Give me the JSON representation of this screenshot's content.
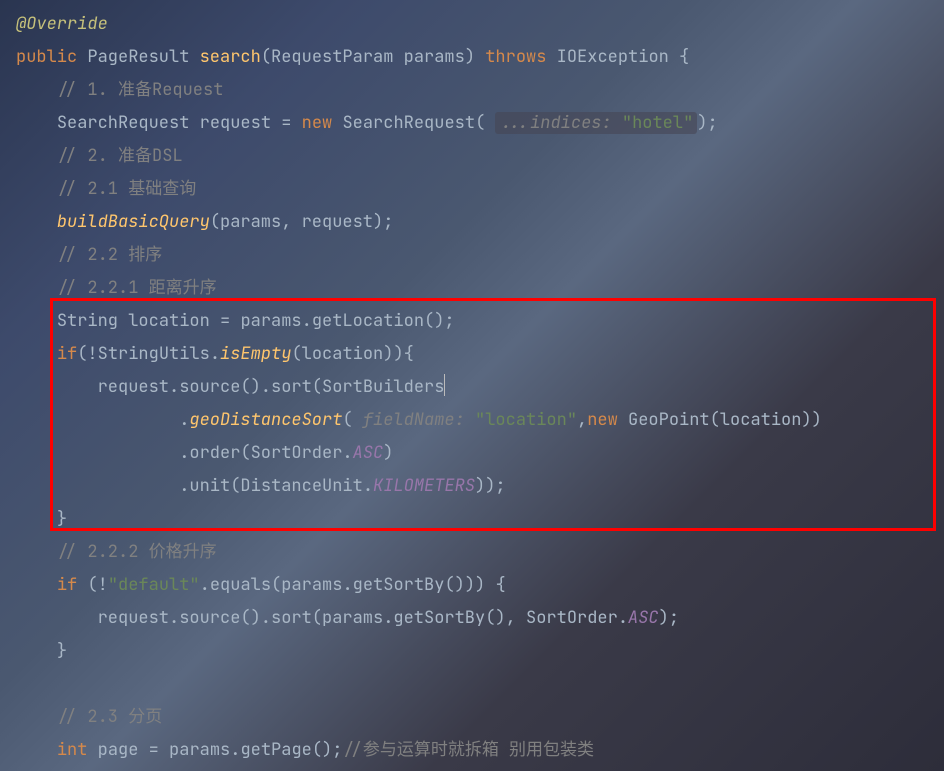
{
  "lines": {
    "l1_anno": "@Override",
    "l2_kw1": "public",
    "l2_type1": "PageResult",
    "l2_method": "search",
    "l2_type2": "RequestParam",
    "l2_param": "params",
    "l2_kw2": "throws",
    "l2_type3": "IOException",
    "l3_comment": "// 1. 准备Request",
    "l4_type": "SearchRequest",
    "l4_var": "request",
    "l4_kw": "new",
    "l4_ctor": "SearchRequest",
    "l4_hint": "...indices:",
    "l4_str": "\"hotel\"",
    "l5_comment": "// 2. 准备DSL",
    "l6_comment": "// 2.1 基础查询",
    "l7_call": "buildBasicQuery",
    "l7_args": "(params, request);",
    "l8_comment": "// 2.2 排序",
    "l9_comment": "// 2.2.1 距离升序",
    "l10_type": "String",
    "l10_var": "location",
    "l10_rhs": "params.getLocation();",
    "l11_kw": "if",
    "l11_cls": "StringUtils",
    "l11_m": "isEmpty",
    "l11_arg": "location",
    "l12_pre": "request.source().sort(",
    "l12_cls": "SortBuilders",
    "l13_m": "geoDistanceSort",
    "l13_hint": "fieldName:",
    "l13_str": "\"location\"",
    "l13_kw": "new",
    "l13_ctor": "GeoPoint",
    "l13_arg": "location",
    "l14_m": "order",
    "l14_cls": "SortOrder",
    "l14_f": "ASC",
    "l15_m": "unit",
    "l15_cls": "DistanceUnit",
    "l15_f": "KILOMETERS",
    "l17_comment": "// 2.2.2 价格升序",
    "l18_kw": "if",
    "l18_str": "\"default\"",
    "l18_m": "equals",
    "l18_args": "params.getSortBy()",
    "l19_pre": "request.source().sort(params.getSortBy(), ",
    "l19_cls": "SortOrder",
    "l19_f": "ASC",
    "l22_comment": "// 2.3 分页",
    "l23_kw": "int",
    "l23_var": "page",
    "l23_rhs": "params.getPage();",
    "l23_comment": "//参与运算时就拆箱 别用包装类"
  }
}
